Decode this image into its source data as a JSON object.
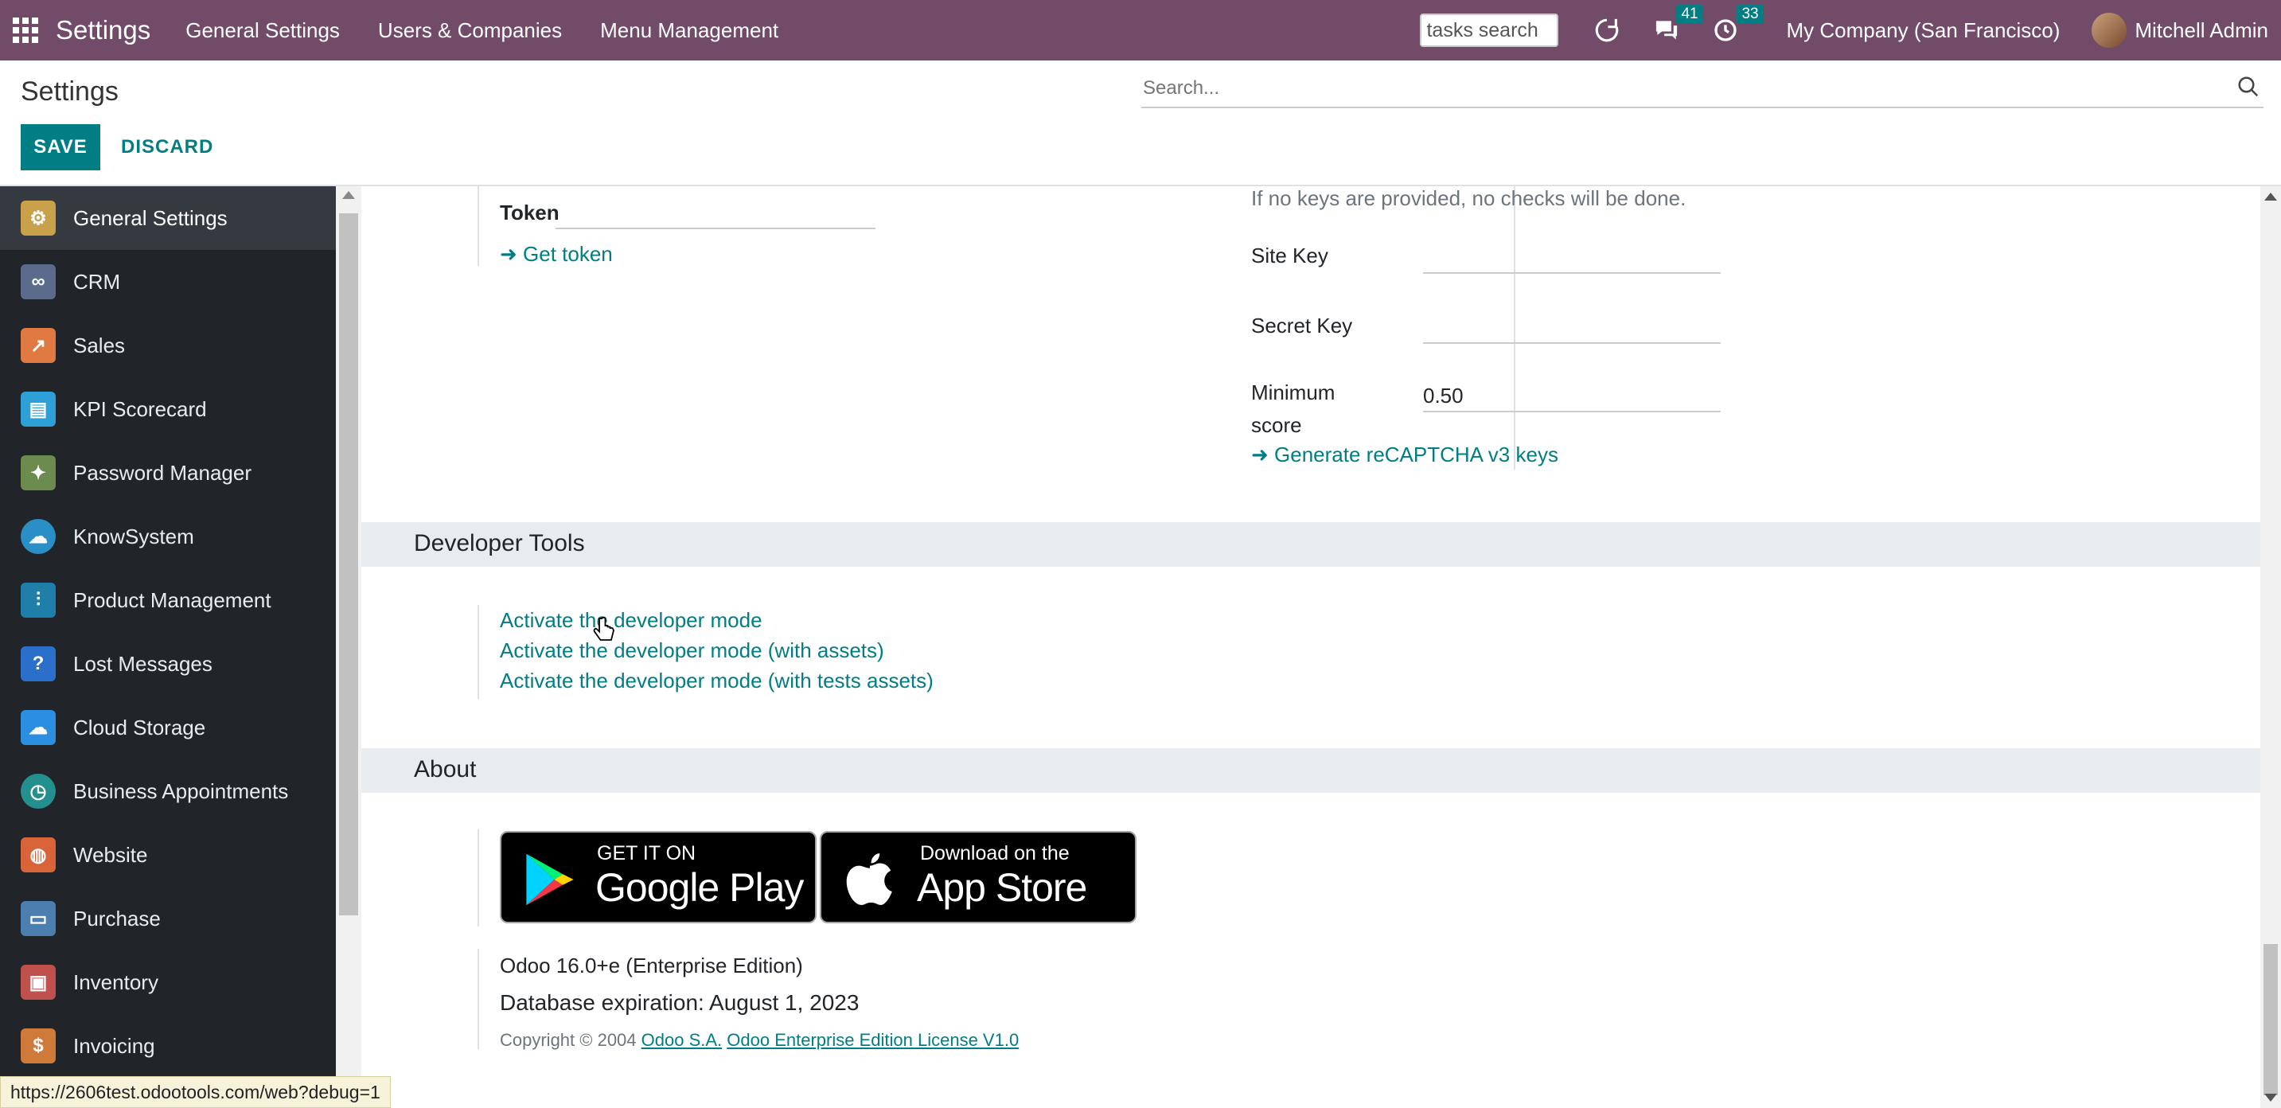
{
  "topbar": {
    "brand": "Settings",
    "menu": [
      "General Settings",
      "Users & Companies",
      "Menu Management"
    ],
    "task_search_value": "tasks search",
    "messages_count": "41",
    "activities_count": "33",
    "company": "My Company (San Francisco)",
    "user": "Mitchell Admin"
  },
  "control_panel": {
    "title": "Settings",
    "save_label": "SAVE",
    "discard_label": "DISCARD",
    "search_placeholder": "Search..."
  },
  "sidebar": {
    "items": [
      {
        "label": "General Settings",
        "icon": "gear-icon",
        "color": "#c9a14a"
      },
      {
        "label": "CRM",
        "icon": "handshake-icon",
        "color": "#5b6b8c"
      },
      {
        "label": "Sales",
        "icon": "chart-up-icon",
        "color": "#e07a42"
      },
      {
        "label": "KPI Scorecard",
        "icon": "scorecard-icon",
        "color": "#2f9fd8"
      },
      {
        "label": "Password Manager",
        "icon": "key-icon",
        "color": "#6c8b4e"
      },
      {
        "label": "KnowSystem",
        "icon": "brain-icon",
        "color": "#2a8fc7"
      },
      {
        "label": "Product Management",
        "icon": "sliders-icon",
        "color": "#1f7fa8"
      },
      {
        "label": "Lost Messages",
        "icon": "user-question-icon",
        "color": "#2a6fc9"
      },
      {
        "label": "Cloud Storage",
        "icon": "cloud-icon",
        "color": "#2b8ee0"
      },
      {
        "label": "Business Appointments",
        "icon": "clock-icon",
        "color": "#23908f"
      },
      {
        "label": "Website",
        "icon": "globe-icon",
        "color": "#d9643a"
      },
      {
        "label": "Purchase",
        "icon": "card-icon",
        "color": "#4a7fb0"
      },
      {
        "label": "Inventory",
        "icon": "box-icon",
        "color": "#c0504d"
      },
      {
        "label": "Invoicing",
        "icon": "invoice-icon",
        "color": "#d07a3a"
      }
    ]
  },
  "content": {
    "token_label": "Token",
    "get_token_link": "Get token",
    "recaptcha_note": "If no keys are provided, no checks will be done.",
    "site_key_label": "Site Key",
    "secret_key_label": "Secret Key",
    "min_score_label_1": "Minimum",
    "min_score_label_2": "score",
    "min_score_value": "0.50",
    "generate_keys_link": "Generate reCAPTCHA v3 keys",
    "developer_tools_title": "Developer Tools",
    "dev_links": [
      "Activate the developer mode",
      "Activate the developer mode (with assets)",
      "Activate the developer mode (with tests assets)"
    ],
    "about_title": "About",
    "google_play_small": "GET IT ON",
    "google_play_big": "Google Play",
    "app_store_small": "Download on the",
    "app_store_big": "App Store",
    "version": "Odoo 16.0+e (Enterprise Edition)",
    "db_expiration": "Database expiration: August 1, 2023",
    "copyright": "Copyright © 2004",
    "company_link": "Odoo S.A.",
    "license_link": "Odoo Enterprise Edition License V1.0"
  },
  "status_bar": {
    "url": "https://2606test.odootools.com/web?debug=1"
  }
}
